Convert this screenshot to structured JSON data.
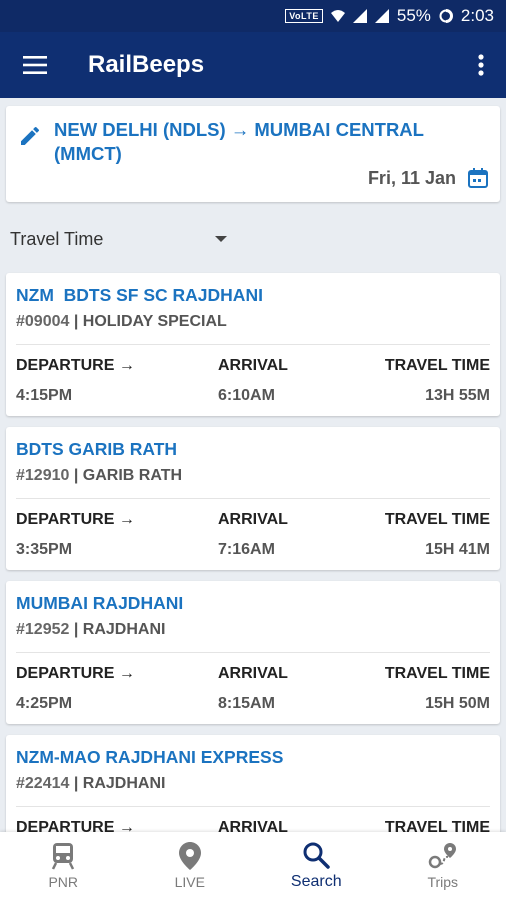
{
  "status": {
    "volte": "VoLTE",
    "battery": "55%",
    "time": "2:03"
  },
  "appbar": {
    "title": "RailBeeps"
  },
  "route": {
    "text": "NEW DELHI (NDLS) → MUMBAI CENTRAL (MMCT)",
    "date": "Fri, 11 Jan"
  },
  "sort": {
    "label": "Travel Time"
  },
  "labels": {
    "departure": "DEPARTURE →",
    "arrival": "ARRIVAL",
    "travel_time": "TRAVEL TIME"
  },
  "trains": [
    {
      "name": "NZM  BDTS SF SC RAJDHANI",
      "number": "#09004",
      "type": "HOLIDAY SPECIAL",
      "departure": "4:15PM",
      "arrival": "6:10AM",
      "travel_time": "13H 55M"
    },
    {
      "name": "BDTS GARIB RATH",
      "number": "#12910",
      "type": "GARIB RATH",
      "departure": "3:35PM",
      "arrival": "7:16AM",
      "travel_time": "15H 41M"
    },
    {
      "name": "MUMBAI RAJDHANI",
      "number": "#12952",
      "type": "RAJDHANI",
      "departure": "4:25PM",
      "arrival": "8:15AM",
      "travel_time": "15H 50M"
    },
    {
      "name": "NZM-MAO RAJDHANI EXPRESS",
      "number": "#22414",
      "type": "RAJDHANI",
      "departure": "",
      "arrival": "",
      "travel_time": ""
    }
  ],
  "nav": [
    {
      "label": "PNR",
      "icon": "train-icon"
    },
    {
      "label": "LIVE",
      "icon": "location-pin-icon"
    },
    {
      "label": "Search",
      "icon": "search-icon",
      "active": true
    },
    {
      "label": "Trips",
      "icon": "trips-route-icon"
    }
  ],
  "colors": {
    "primary": "#0f2f72",
    "accent": "#1b73c0"
  }
}
